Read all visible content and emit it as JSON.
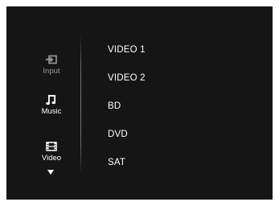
{
  "sidebar": {
    "items": [
      {
        "label": "Input",
        "icon": "input-icon",
        "state": "dim"
      },
      {
        "label": "Music",
        "icon": "music-note-icon",
        "state": "active"
      },
      {
        "label": "Video",
        "icon": "film-strip-icon",
        "state": "active"
      }
    ],
    "more_icon": "chevron-down-icon"
  },
  "sources": [
    "VIDEO 1",
    "VIDEO 2",
    "BD",
    "DVD",
    "SAT"
  ],
  "colors": {
    "background": "#151515",
    "text_active": "#ffffff",
    "text_dim": "#9a9a9a"
  }
}
